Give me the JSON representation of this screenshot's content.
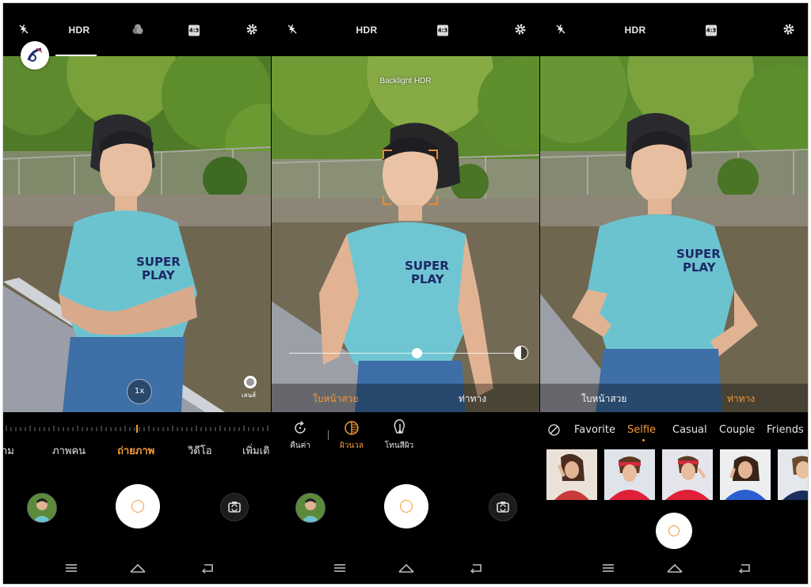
{
  "panels": [
    {
      "id": "photo-mode",
      "top_bar": {
        "hdr_label": "HDR",
        "ratio_label": "4:3"
      },
      "zoom_label": "1x",
      "lens_label": "เลนส์",
      "modes": [
        "าม",
        "ภาพคน",
        "ถ่ายภาพ",
        "วิดีโอ",
        "เพิ่มเติ"
      ],
      "active_mode": "ถ่ายภาพ"
    },
    {
      "id": "beauty-mode",
      "top_bar": {
        "hdr_label": "HDR",
        "ratio_label": "4:3"
      },
      "hint": "Backlight HDR",
      "beauty_tabs": [
        "ใบหน้าสวย",
        "ท่าทาง"
      ],
      "active_beauty_tab": "ใบหน้าสวย",
      "tools": [
        {
          "label": "คืนค่า",
          "icon": "reset-icon"
        },
        {
          "label": "ผิวนวล",
          "icon": "skin-smooth-icon"
        },
        {
          "label": "โทนสีผิว",
          "icon": "skin-tone-icon"
        }
      ],
      "active_tool": "ผิวนวล",
      "slider_value": 0.55
    },
    {
      "id": "pose-mode",
      "top_bar": {
        "hdr_label": "HDR",
        "ratio_label": "4:3"
      },
      "beauty_tabs": [
        "ใบหน้าสวย",
        "ท่าทาง"
      ],
      "active_beauty_tab": "ท่าทาง",
      "filters": [
        "Favorite",
        "Selfie",
        "Casual",
        "Couple",
        "Friends"
      ],
      "active_filter": "Selfie",
      "pose_thumbnails": 5
    }
  ],
  "colors": {
    "accent": "#f49a3a",
    "background": "#000000",
    "focus": "#f08a2a"
  },
  "icons": {
    "flash_off": "flash-off-icon",
    "filters": "filters-icon",
    "settings": "gear-icon",
    "gallery": "gallery-thumbnail",
    "switch_camera": "switch-camera-icon",
    "nav_menu": "menu-icon",
    "nav_home": "home-icon",
    "nav_back": "back-icon"
  }
}
